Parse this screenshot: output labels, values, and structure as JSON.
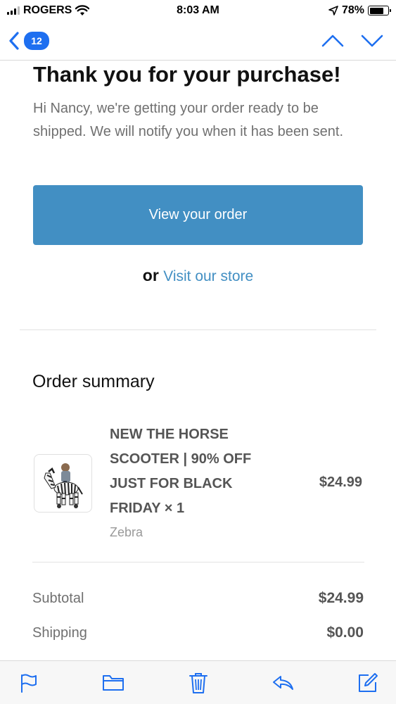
{
  "status_bar": {
    "carrier": "ROGERS",
    "time": "8:03 AM",
    "battery": "78%",
    "battery_level": 0.78,
    "icons": [
      "signal-icon",
      "wifi-icon",
      "location-arrow-icon",
      "battery-icon"
    ]
  },
  "nav": {
    "unread_count": "12",
    "icons": [
      "back-chevron-icon",
      "up-chevron-icon",
      "down-chevron-icon"
    ]
  },
  "email": {
    "title": "Thank you for your purchase!",
    "intro": "Hi Nancy, we're getting your order ready to be shipped. We will notify you when it has been sent.",
    "cta_label": "View your order",
    "or_text": "or",
    "store_link": "Visit our store"
  },
  "order_summary": {
    "heading": "Order summary",
    "item": {
      "name": "NEW THE HORSE SCOOTER | 90% OFF JUST FOR BLACK FRIDAY × 1",
      "variant": "Zebra",
      "price": "$24.99",
      "image": "zebra-ride-on-toy"
    },
    "subtotal_label": "Subtotal",
    "subtotal_value": "$24.99",
    "shipping_label": "Shipping",
    "shipping_value": "$0.00"
  },
  "toolbar": {
    "icons": [
      "flag-icon",
      "folder-icon",
      "trash-icon",
      "reply-icon",
      "compose-icon"
    ]
  },
  "colors": {
    "accent": "#1e6ff0",
    "button": "#428fc3",
    "link": "#428fc3",
    "muted_text": "#707070"
  }
}
